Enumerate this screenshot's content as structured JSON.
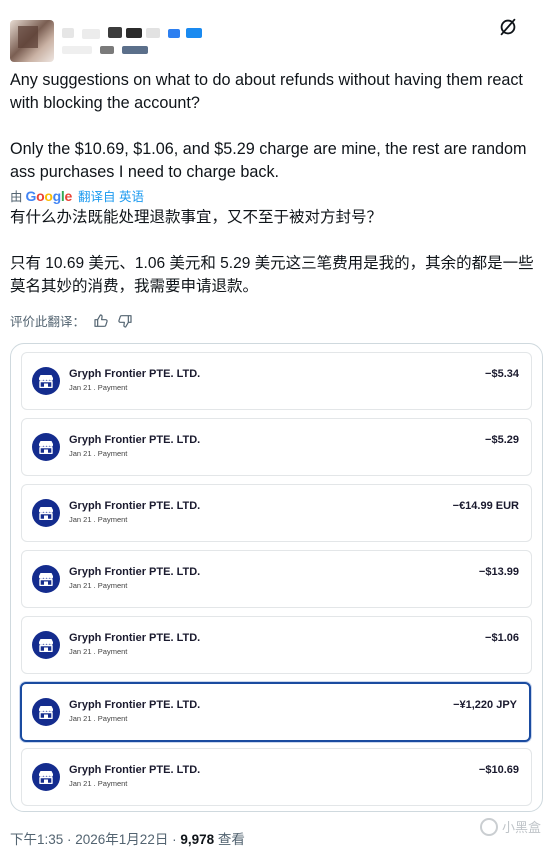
{
  "header": {
    "more_icon": "slash-circle-icon"
  },
  "tweet": {
    "paragraphs": [
      "Any suggestions on what to do about refunds without having them react with blocking the account?",
      "Only the $10.69, $1.06, and $5.29 charge are mine, the rest are random ass purchases I need to charge back."
    ]
  },
  "translation": {
    "by_label": "由",
    "google_letters": [
      "G",
      "o",
      "o",
      "g",
      "l",
      "e"
    ],
    "link_label": "翻译自 英语",
    "paragraphs": [
      "有什么办法既能处理退款事宜，又不至于被对方封号？",
      "只有 10.69 美元、1.06 美元和 5.29 美元这三笔费用是我的，其余的都是一些莫名其妙的消费，我需要申请退款。"
    ],
    "rate_label": "评价此翻译："
  },
  "transactions": [
    {
      "merchant": "Gryph Frontier PTE. LTD.",
      "subtitle": "Jan 21 . Payment",
      "amount": "−$5.34"
    },
    {
      "merchant": "Gryph Frontier PTE. LTD.",
      "subtitle": "Jan 21 . Payment",
      "amount": "−$5.29"
    },
    {
      "merchant": "Gryph Frontier PTE. LTD.",
      "subtitle": "Jan 21 . Payment",
      "amount": "−€14.99 EUR"
    },
    {
      "merchant": "Gryph Frontier PTE. LTD.",
      "subtitle": "Jan 21 . Payment",
      "amount": "−$13.99"
    },
    {
      "merchant": "Gryph Frontier PTE. LTD.",
      "subtitle": "Jan 21 . Payment",
      "amount": "−$1.06"
    },
    {
      "merchant": "Gryph Frontier PTE. LTD.",
      "subtitle": "Jan 21 . Payment",
      "amount": "−¥1,220 JPY"
    },
    {
      "merchant": "Gryph Frontier PTE. LTD.",
      "subtitle": "Jan 21 . Payment",
      "amount": "−$10.69"
    }
  ],
  "meta": {
    "time": "下午1:35 · 2026年1月22日 · ",
    "views": "9,978",
    "views_label": " 查看"
  },
  "watermark": {
    "text": "小黑盒"
  },
  "colors": {
    "accent": "#1d9bf0",
    "icon_bg": "#142c8e",
    "selected_border": "#1a4ba0"
  }
}
